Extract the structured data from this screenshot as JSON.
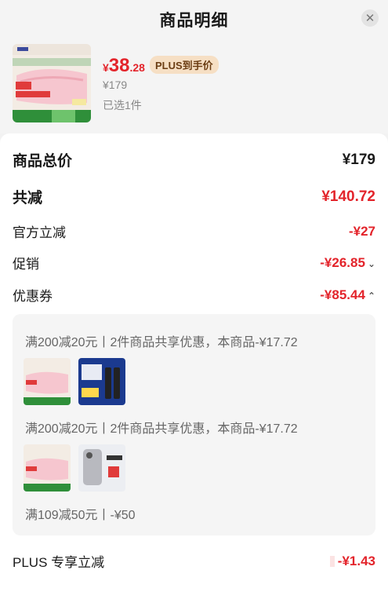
{
  "header": {
    "title": "商品明细",
    "close_icon": "✕"
  },
  "product": {
    "price_symbol": "¥",
    "price_int": "38",
    "price_dec": ".28",
    "plus_tag": "PLUS到手价",
    "original_price": "¥179",
    "selected": "已选1件"
  },
  "summary": {
    "total_label": "商品总价",
    "total_value": "¥179",
    "discount_label": "共减",
    "discount_value": "¥140.72",
    "official_label": "官方立减",
    "official_value": "-¥27",
    "promo_label": "促销",
    "promo_value": "-¥26.85",
    "coupon_label": "优惠券",
    "coupon_value": "-¥85.44"
  },
  "coupons": {
    "line1": "满200减20元丨2件商品共享优惠，本商品-¥17.72",
    "line2": "满200减20元丨2件商品共享优惠，本商品-¥17.72",
    "line3": "满109减50元丨-¥50"
  },
  "plus": {
    "label": "PLUS 专享立减",
    "value": "-¥1.43"
  },
  "colors": {
    "accent": "#e3242b",
    "plus_bg": "#f6dfc4"
  }
}
